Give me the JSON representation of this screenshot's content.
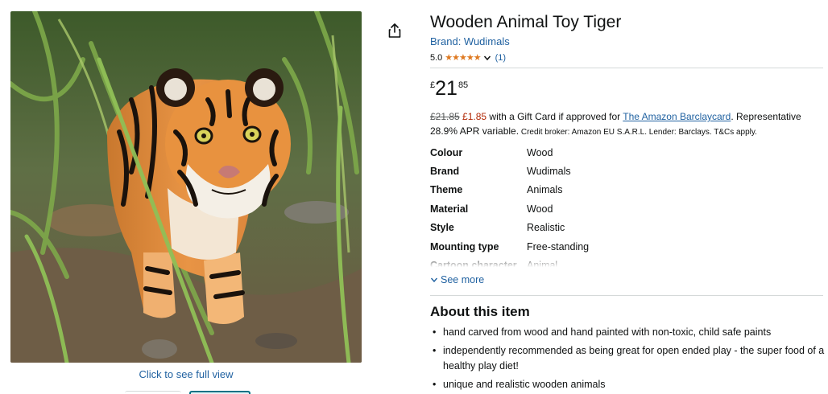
{
  "product": {
    "title": "Wooden Animal Toy Tiger",
    "brand_link": "Brand: Wudimals",
    "rating_value": "5.0",
    "stars": "★★★★★",
    "rating_count": "(1)"
  },
  "price": {
    "currency": "£",
    "whole": "21",
    "fraction": "85"
  },
  "gift_card": {
    "old_price": "£21.85",
    "discount": "£1.85",
    "text_before_link": " with a Gift Card if approved for ",
    "link": "The Amazon Barclaycard",
    "text_after_link": ". Representative 28.9% APR variable.",
    "small_print": " Credit broker: Amazon EU S.A.R.L. Lender: Barclays. T&Cs apply."
  },
  "specs": [
    {
      "key": "Colour",
      "value": "Wood"
    },
    {
      "key": "Brand",
      "value": "Wudimals"
    },
    {
      "key": "Theme",
      "value": "Animals"
    },
    {
      "key": "Material",
      "value": "Wood"
    },
    {
      "key": "Style",
      "value": "Realistic"
    },
    {
      "key": "Mounting type",
      "value": "Free-standing"
    },
    {
      "key": "Cartoon character",
      "value": "Animal"
    }
  ],
  "see_more": "See more",
  "about": {
    "heading": "About this item",
    "bullets": [
      "hand carved from wood and hand painted with non-toxic, child safe paints",
      "independently recommended as being great for open ended play - the super food of a healthy play diet!",
      "unique and realistic wooden animals"
    ]
  },
  "image": {
    "click_to_view": "Click to see full view"
  },
  "icons": {
    "share": "share-icon",
    "chevron": "chevron-down-icon"
  },
  "colors": {
    "link": "#2162a1",
    "star": "#de7921",
    "price_red": "#b12704",
    "thumb_selected": "#007185"
  }
}
